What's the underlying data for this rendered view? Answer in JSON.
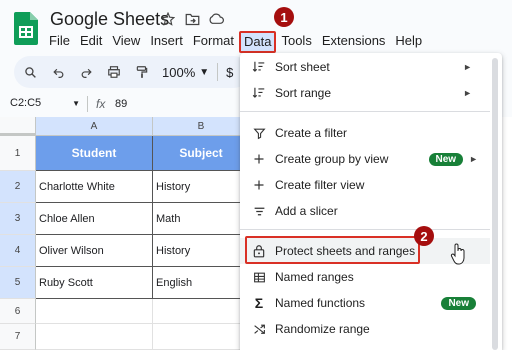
{
  "app": {
    "title": "Google Sheets"
  },
  "menubar": [
    "File",
    "Edit",
    "View",
    "Insert",
    "Format",
    "Data",
    "Tools",
    "Extensions",
    "Help"
  ],
  "toolbar": {
    "zoom": "100%",
    "currency": "$"
  },
  "formula_bar": {
    "name_box": "C2:C5",
    "fx": "fx",
    "value": "89"
  },
  "columns": [
    "A",
    "B"
  ],
  "rows": [
    "1",
    "2",
    "3",
    "4",
    "5",
    "6",
    "7"
  ],
  "table": {
    "headers": [
      "Student",
      "Subject"
    ],
    "cells": [
      [
        "Charlotte White",
        "History"
      ],
      [
        "Chloe Allen",
        "Math"
      ],
      [
        "Oliver Wilson",
        "History"
      ],
      [
        "Ruby Scott",
        "English"
      ]
    ]
  },
  "data_menu": {
    "items": [
      {
        "label": "Sort sheet",
        "icon": "sort-icon",
        "submenu": true
      },
      {
        "label": "Sort range",
        "icon": "sort-range-icon",
        "submenu": true
      },
      {
        "label": "Create a filter",
        "icon": "filter-icon"
      },
      {
        "label": "Create group by view",
        "icon": "plus-icon",
        "badge": "New",
        "submenu": true
      },
      {
        "label": "Create filter view",
        "icon": "plus-icon"
      },
      {
        "label": "Add a slicer",
        "icon": "slicer-icon"
      },
      {
        "label": "Protect sheets and ranges",
        "icon": "lock-icon"
      },
      {
        "label": "Named ranges",
        "icon": "table-icon"
      },
      {
        "label": "Named functions",
        "icon": "sigma-icon",
        "badge": "New"
      },
      {
        "label": "Randomize range",
        "icon": "shuffle-icon"
      }
    ]
  },
  "annotations": {
    "step1": "1",
    "step2": "2"
  },
  "colors": {
    "accent": "#d93025",
    "step_badge": "#a50e0e",
    "header_fill": "#6d9eeb",
    "new_badge": "#188038",
    "selection": "#d3e3fd"
  }
}
